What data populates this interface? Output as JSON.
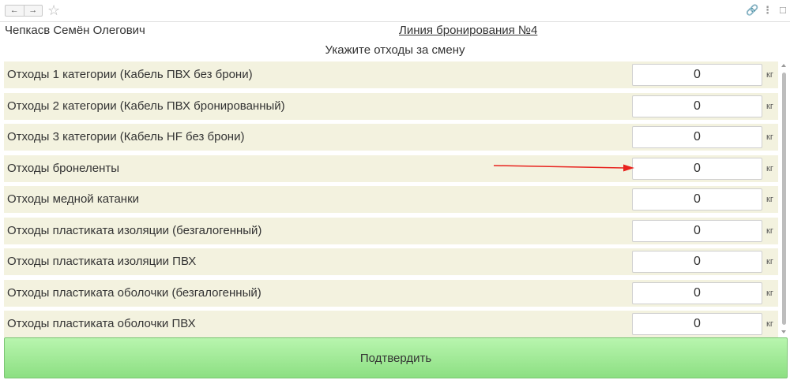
{
  "toolbar": {
    "back_label": "←",
    "forward_label": "→",
    "star_label": "☆",
    "link_label": "🔗",
    "more_label": "⋮",
    "maximize_label": "☐"
  },
  "header": {
    "user_name": "Чепкасв Семён Олегович",
    "line_title": "Линия бронирования №4",
    "subtitle": "Укажите отходы за смену"
  },
  "rows": [
    {
      "label": "Отходы 1 категории (Кабель ПВХ без брони)",
      "value": "0",
      "unit": "кг"
    },
    {
      "label": "Отходы 2 категории (Кабель ПВХ бронированный)",
      "value": "0",
      "unit": "кг"
    },
    {
      "label": "Отходы 3 категории (Кабель HF без брони)",
      "value": "0",
      "unit": "кг"
    },
    {
      "label": "Отходы броне­ленты",
      "value": "0",
      "unit": "кг"
    },
    {
      "label": "Отходы медной катанки",
      "value": "0",
      "unit": "кг"
    },
    {
      "label": "Отходы пластиката изоляции (безгалогенный)",
      "value": "0",
      "unit": "кг"
    },
    {
      "label": "Отходы пластиката изоляции ПВХ",
      "value": "0",
      "unit": "кг"
    },
    {
      "label": "Отходы пластиката оболочки (безгалогенный)",
      "value": "0",
      "unit": "кг"
    },
    {
      "label": "Отходы пластиката оболочки ПВХ",
      "value": "0",
      "unit": "кг"
    }
  ],
  "confirm_label": "Подтвердить",
  "colors": {
    "row_background": "#f3f2df",
    "confirm_button": "#9fe895",
    "annotation_arrow": "#e8231e"
  },
  "icons": {
    "back": "arrow-left-icon",
    "forward": "arrow-right-icon",
    "favorite": "star-icon",
    "link": "link-icon",
    "more": "more-vertical-icon",
    "maximize": "maximize-icon"
  }
}
